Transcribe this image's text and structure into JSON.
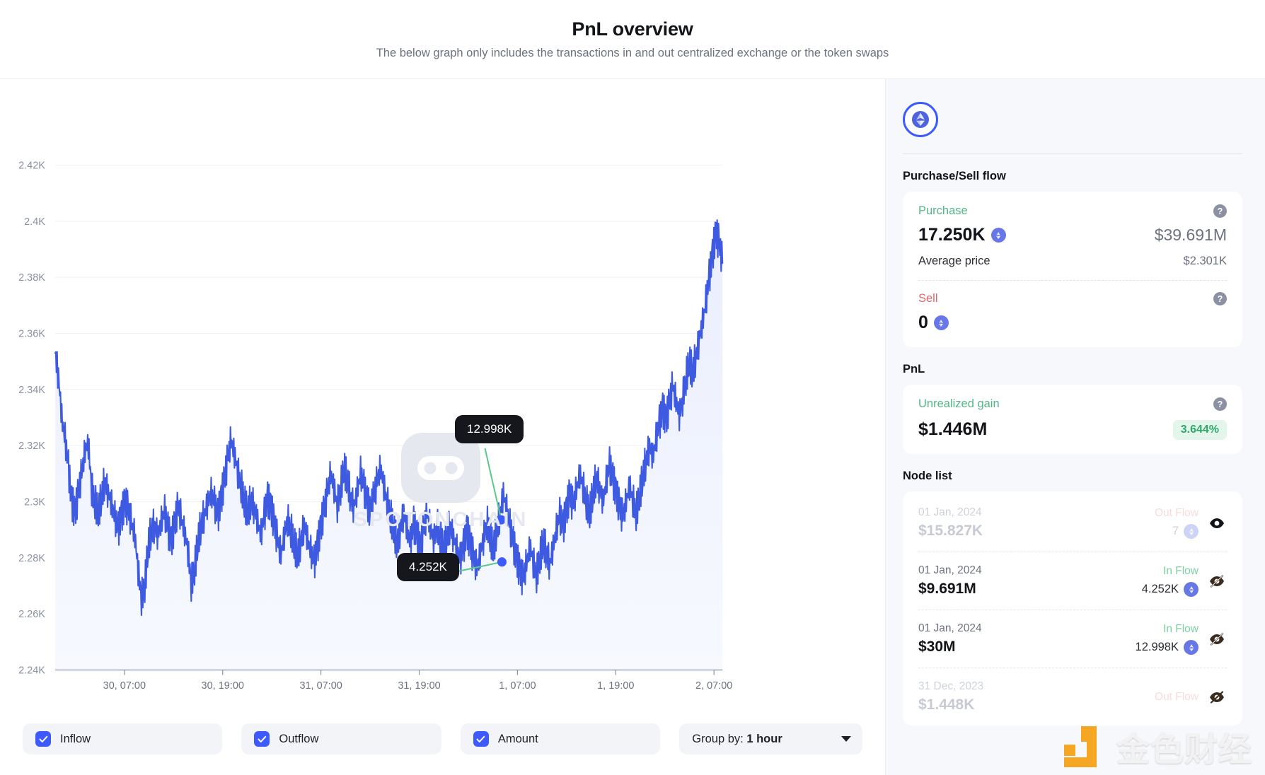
{
  "header": {
    "title": "PnL overview",
    "subtitle": "The below graph only includes the transactions in and out centralized exchange or the token swaps"
  },
  "chart_data": {
    "type": "line",
    "title": "PnL overview",
    "xlabel": "",
    "ylabel": "",
    "ylim": [
      2.24,
      2.42
    ],
    "ytick_labels": [
      "2.42K",
      "2.4K",
      "2.38K",
      "2.36K",
      "2.34K",
      "2.32K",
      "2.3K",
      "2.28K",
      "2.26K",
      "2.24K"
    ],
    "ytick_values": [
      2420,
      2400,
      2380,
      2360,
      2340,
      2320,
      2300,
      2280,
      2260,
      2240
    ],
    "xtick_labels": [
      "30, 07:00",
      "30, 19:00",
      "31, 07:00",
      "31, 19:00",
      "1, 07:00",
      "1, 19:00",
      "2, 07:00"
    ],
    "grid": true,
    "legend": "none",
    "series": [
      {
        "name": "Amount",
        "color": "#3d5ae0",
        "fill": "#eef1fd",
        "values": [
          2353,
          2345,
          2330,
          2322,
          2312,
          2300,
          2296,
          2303,
          2310,
          2318,
          2321,
          2305,
          2300,
          2296,
          2302,
          2308,
          2303,
          2299,
          2294,
          2290,
          2295,
          2300,
          2297,
          2292,
          2288,
          2276,
          2266,
          2270,
          2284,
          2290,
          2292,
          2288,
          2293,
          2296,
          2290,
          2286,
          2292,
          2298,
          2294,
          2289,
          2283,
          2271,
          2276,
          2286,
          2292,
          2296,
          2300,
          2303,
          2299,
          2295,
          2301,
          2308,
          2315,
          2322,
          2317,
          2311,
          2306,
          2300,
          2296,
          2301,
          2298,
          2293,
          2288,
          2295,
          2301,
          2298,
          2292,
          2286,
          2281,
          2288,
          2294,
          2290,
          2285,
          2281,
          2286,
          2292,
          2287,
          2282,
          2278,
          2284,
          2291,
          2297,
          2303,
          2310,
          2305,
          2299,
          2305,
          2312,
          2308,
          2302,
          2298,
          2304,
          2310,
          2305,
          2300,
          2296,
          2302,
          2307,
          2312,
          2306,
          2300,
          2295,
          2290,
          2285,
          2291,
          2296,
          2290,
          2285,
          2292,
          2288,
          2283,
          2290,
          2296,
          2291,
          2286,
          2292,
          2287,
          2283,
          2288,
          2292,
          2287,
          2283,
          2279,
          2284,
          2290,
          2285,
          2280,
          2276,
          2281,
          2287,
          2293,
          2288,
          2283,
          2290,
          2296,
          2303,
          2297,
          2291,
          2285,
          2280,
          2275,
          2272,
          2278,
          2284,
          2279,
          2274,
          2280,
          2286,
          2282,
          2278,
          2284,
          2290,
          2295,
          2291,
          2297,
          2303,
          2298,
          2304,
          2310,
          2306,
          2300,
          2296,
          2303,
          2309,
          2305,
          2300,
          2307,
          2313,
          2308,
          2303,
          2298,
          2294,
          2300,
          2306,
          2301,
          2296,
          2302,
          2309,
          2315,
          2320,
          2316,
          2322,
          2328,
          2333,
          2329,
          2335,
          2341,
          2336,
          2331,
          2337,
          2344,
          2350,
          2346,
          2352,
          2358,
          2364,
          2371,
          2380,
          2388,
          2396,
          2392,
          2385
        ]
      }
    ],
    "annotations": [
      {
        "label": "12.998K",
        "value_eth": 12998,
        "type": "In Flow"
      },
      {
        "label": "4.252K",
        "value_eth": 4252,
        "type": "In Flow"
      }
    ],
    "watermark": "SPOTONCHAIN"
  },
  "controls": {
    "inflow_label": "Inflow",
    "inflow_checked": true,
    "outflow_label": "Outflow",
    "outflow_checked": true,
    "amount_label": "Amount",
    "amount_checked": true,
    "group_by_prefix": "Group by:",
    "group_by_value": "1 hour"
  },
  "right_panel": {
    "token_icon": "ethereum-icon",
    "purchase_sell": {
      "section_title": "Purchase/Sell flow",
      "purchase_label": "Purchase",
      "purchase_amount": "17.250K",
      "purchase_usd": "$39.691M",
      "avg_price_label": "Average price",
      "avg_price_value": "$2.301K",
      "sell_label": "Sell",
      "sell_amount": "0",
      "help_icon": "question-icon"
    },
    "pnl": {
      "section_title": "PnL",
      "gain_label": "Unrealized gain",
      "gain_value": "$1.446M",
      "gain_percent": "3.644%",
      "help_icon": "question-icon"
    },
    "node_list": {
      "section_title": "Node list",
      "rows": [
        {
          "date": "01 Jan, 2024",
          "usd": "$15.827K",
          "flow_type": "Out Flow",
          "qty": "7",
          "eye_icon": "eye-icon",
          "hidden": true
        },
        {
          "date": "01 Jan, 2024",
          "usd": "$9.691M",
          "flow_type": "In Flow",
          "qty": "4.252K",
          "eye_icon": "eye-off-icon",
          "hidden": false
        },
        {
          "date": "01 Jan, 2024",
          "usd": "$30M",
          "flow_type": "In Flow",
          "qty": "12.998K",
          "eye_icon": "eye-off-icon",
          "hidden": false
        },
        {
          "date": "31 Dec, 2023",
          "usd": "$1.448K",
          "flow_type": "Out Flow",
          "qty": "",
          "eye_icon": "eye-off-icon",
          "hidden": true
        }
      ]
    }
  },
  "watermark": {
    "chart": "SPOTONCHAIN",
    "corner_text": "金色财经"
  },
  "colors": {
    "accent": "#3d5afe",
    "line": "#3d5ae0",
    "green": "#52b788",
    "red": "#e5646b",
    "gain_badge_bg": "#e4f6ec"
  }
}
